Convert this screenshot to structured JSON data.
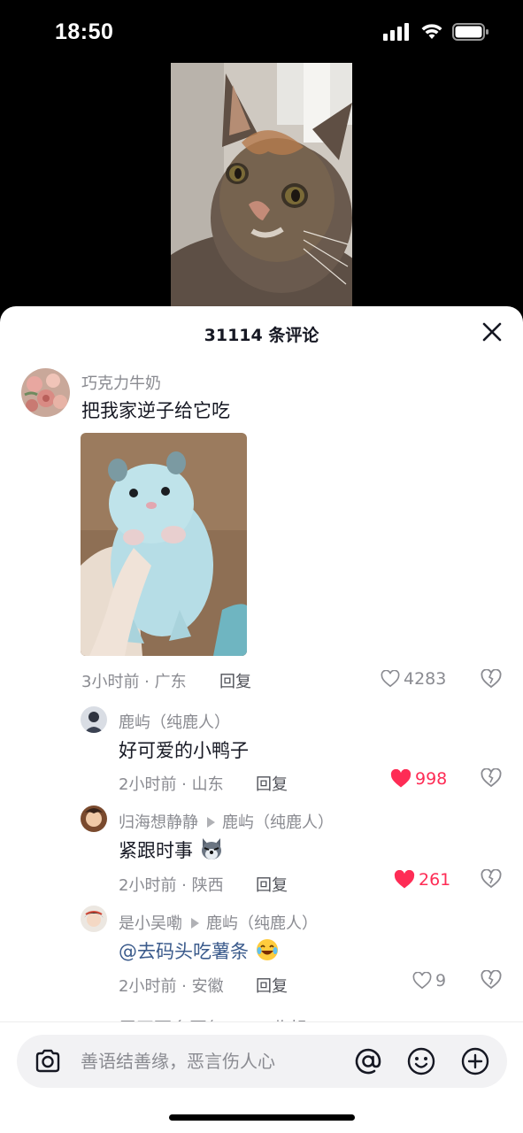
{
  "status_bar": {
    "time": "18:50"
  },
  "sheet": {
    "title": "31114 条评论"
  },
  "comments": [
    {
      "user": "巧克力牛奶",
      "text": "把我家逆子给它吃",
      "time_location": "3小时前 · 广东",
      "reply_label": "回复",
      "likes": "4283",
      "liked": false,
      "replies": [
        {
          "user": "鹿屿（纯鹿人）",
          "text": "好可爱的小鸭子",
          "time_location": "2小时前 · 山东",
          "reply_label": "回复",
          "likes": "998",
          "liked": true
        },
        {
          "user": "归海想静静",
          "reply_to": "鹿屿（纯鹿人）",
          "text": "紧跟时事",
          "time_location": "2小时前 · 陕西",
          "reply_label": "回复",
          "likes": "261",
          "liked": true
        },
        {
          "user": "是小吴嘞",
          "reply_to": "鹿屿（纯鹿人）",
          "mention": "@去码头吃薯条",
          "time_location": "2小时前 · 安徽",
          "reply_label": "回复",
          "likes": "9",
          "liked": false
        }
      ]
    }
  ],
  "partial_row_text": "展开更多回复 —— 收起",
  "input": {
    "placeholder": "善语结善缘，恶言伤人心"
  },
  "colors": {
    "like_active": "#fe2c55",
    "mention": "#3b5b8c",
    "muted": "#8a8b91"
  }
}
